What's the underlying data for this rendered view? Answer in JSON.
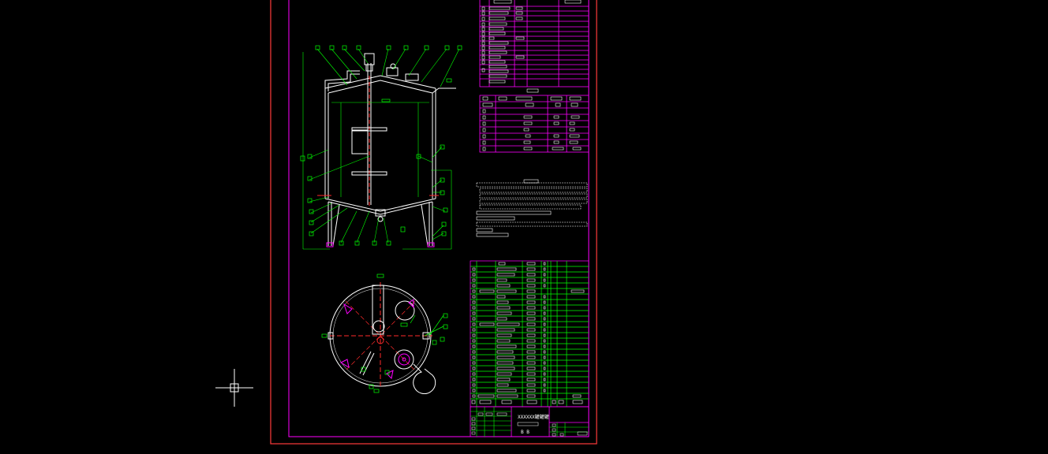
{
  "drawing": {
    "background": "#000000",
    "frame_color": "#ff3b3b",
    "inner_frame_color": "#ff00ff",
    "table_line_color": "#ff00ff",
    "dim_color": "#00ff00",
    "geometry_color": "#ffffff",
    "hidden_color": "#ff2a2a",
    "cursor_color": "#ffffff"
  },
  "title_block": {
    "text": "XXXXXX罐罐罐",
    "text2": "B  B"
  },
  "icons": {
    "cursor": "crosshair-cursor-icon"
  }
}
